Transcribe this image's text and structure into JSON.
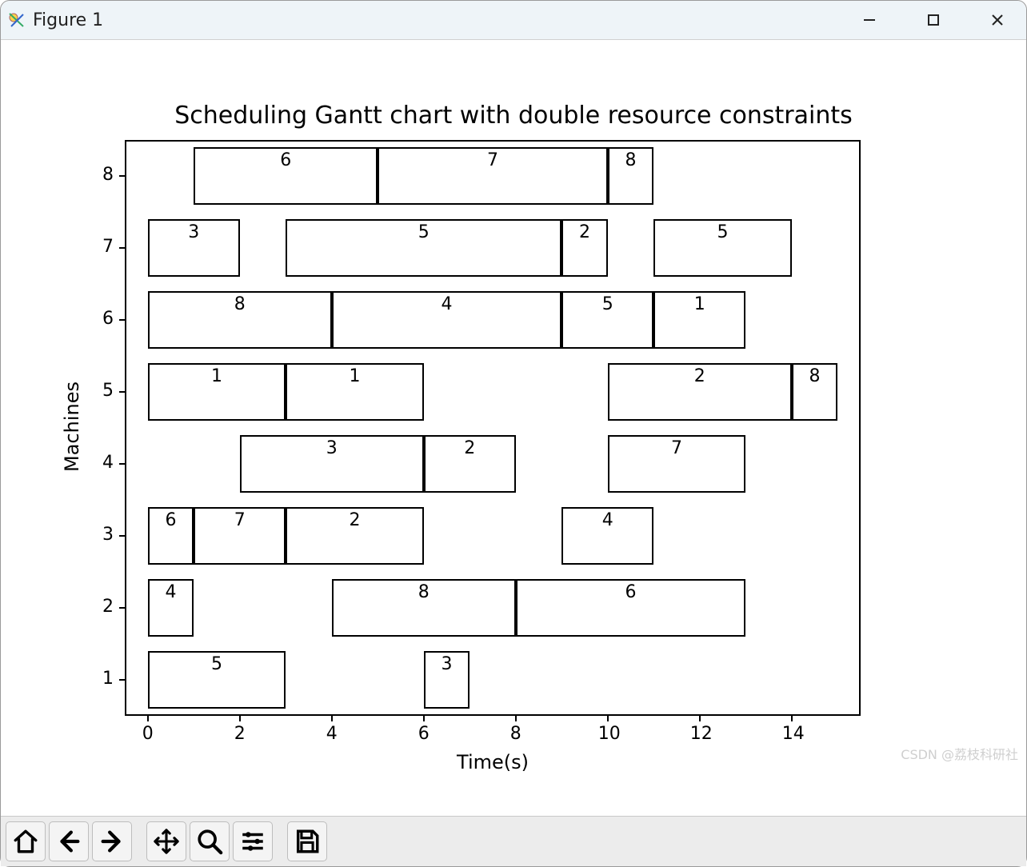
{
  "window": {
    "title": "Figure 1"
  },
  "toolbar": {
    "home": "Home",
    "back": "Back",
    "forward": "Forward",
    "pan": "Pan",
    "zoom": "Zoom",
    "subplots": "Configure subplots",
    "save": "Save"
  },
  "watermark": "CSDN @荔枝科研社",
  "chart_data": {
    "type": "gantt",
    "title": "Scheduling Gantt chart with double resource constraints",
    "xlabel": "Time(s)",
    "ylabel": "Machines",
    "xlim": [
      -0.5,
      15.5
    ],
    "ylim": [
      0.5,
      8.5
    ],
    "xticks": [
      0,
      2,
      4,
      6,
      8,
      10,
      12,
      14
    ],
    "yticks": [
      1,
      2,
      3,
      4,
      5,
      6,
      7,
      8
    ],
    "bar_height": 0.8,
    "bars": [
      {
        "machine": 1,
        "start": 0,
        "end": 3,
        "label": "5"
      },
      {
        "machine": 1,
        "start": 6,
        "end": 7,
        "label": "3"
      },
      {
        "machine": 2,
        "start": 0,
        "end": 1,
        "label": "4"
      },
      {
        "machine": 2,
        "start": 4,
        "end": 8,
        "label": "8"
      },
      {
        "machine": 2,
        "start": 8,
        "end": 13,
        "label": "6"
      },
      {
        "machine": 3,
        "start": 0,
        "end": 1,
        "label": "6"
      },
      {
        "machine": 3,
        "start": 1,
        "end": 3,
        "label": "7"
      },
      {
        "machine": 3,
        "start": 3,
        "end": 6,
        "label": "2"
      },
      {
        "machine": 3,
        "start": 9,
        "end": 11,
        "label": "4"
      },
      {
        "machine": 4,
        "start": 2,
        "end": 6,
        "label": "3"
      },
      {
        "machine": 4,
        "start": 6,
        "end": 8,
        "label": "2"
      },
      {
        "machine": 4,
        "start": 10,
        "end": 13,
        "label": "7"
      },
      {
        "machine": 5,
        "start": 0,
        "end": 3,
        "label": "1"
      },
      {
        "machine": 5,
        "start": 3,
        "end": 6,
        "label": "1"
      },
      {
        "machine": 5,
        "start": 10,
        "end": 14,
        "label": "2"
      },
      {
        "machine": 5,
        "start": 14,
        "end": 15,
        "label": "8"
      },
      {
        "machine": 6,
        "start": 0,
        "end": 4,
        "label": "8"
      },
      {
        "machine": 6,
        "start": 4,
        "end": 9,
        "label": "4"
      },
      {
        "machine": 6,
        "start": 9,
        "end": 11,
        "label": "5"
      },
      {
        "machine": 6,
        "start": 11,
        "end": 13,
        "label": "1"
      },
      {
        "machine": 7,
        "start": 0,
        "end": 2,
        "label": "3"
      },
      {
        "machine": 7,
        "start": 3,
        "end": 9,
        "label": "5"
      },
      {
        "machine": 7,
        "start": 9,
        "end": 10,
        "label": "2"
      },
      {
        "machine": 7,
        "start": 11,
        "end": 14,
        "label": "5"
      },
      {
        "machine": 8,
        "start": 1,
        "end": 5,
        "label": "6"
      },
      {
        "machine": 8,
        "start": 5,
        "end": 10,
        "label": "7"
      },
      {
        "machine": 8,
        "start": 10,
        "end": 11,
        "label": "8"
      }
    ]
  }
}
